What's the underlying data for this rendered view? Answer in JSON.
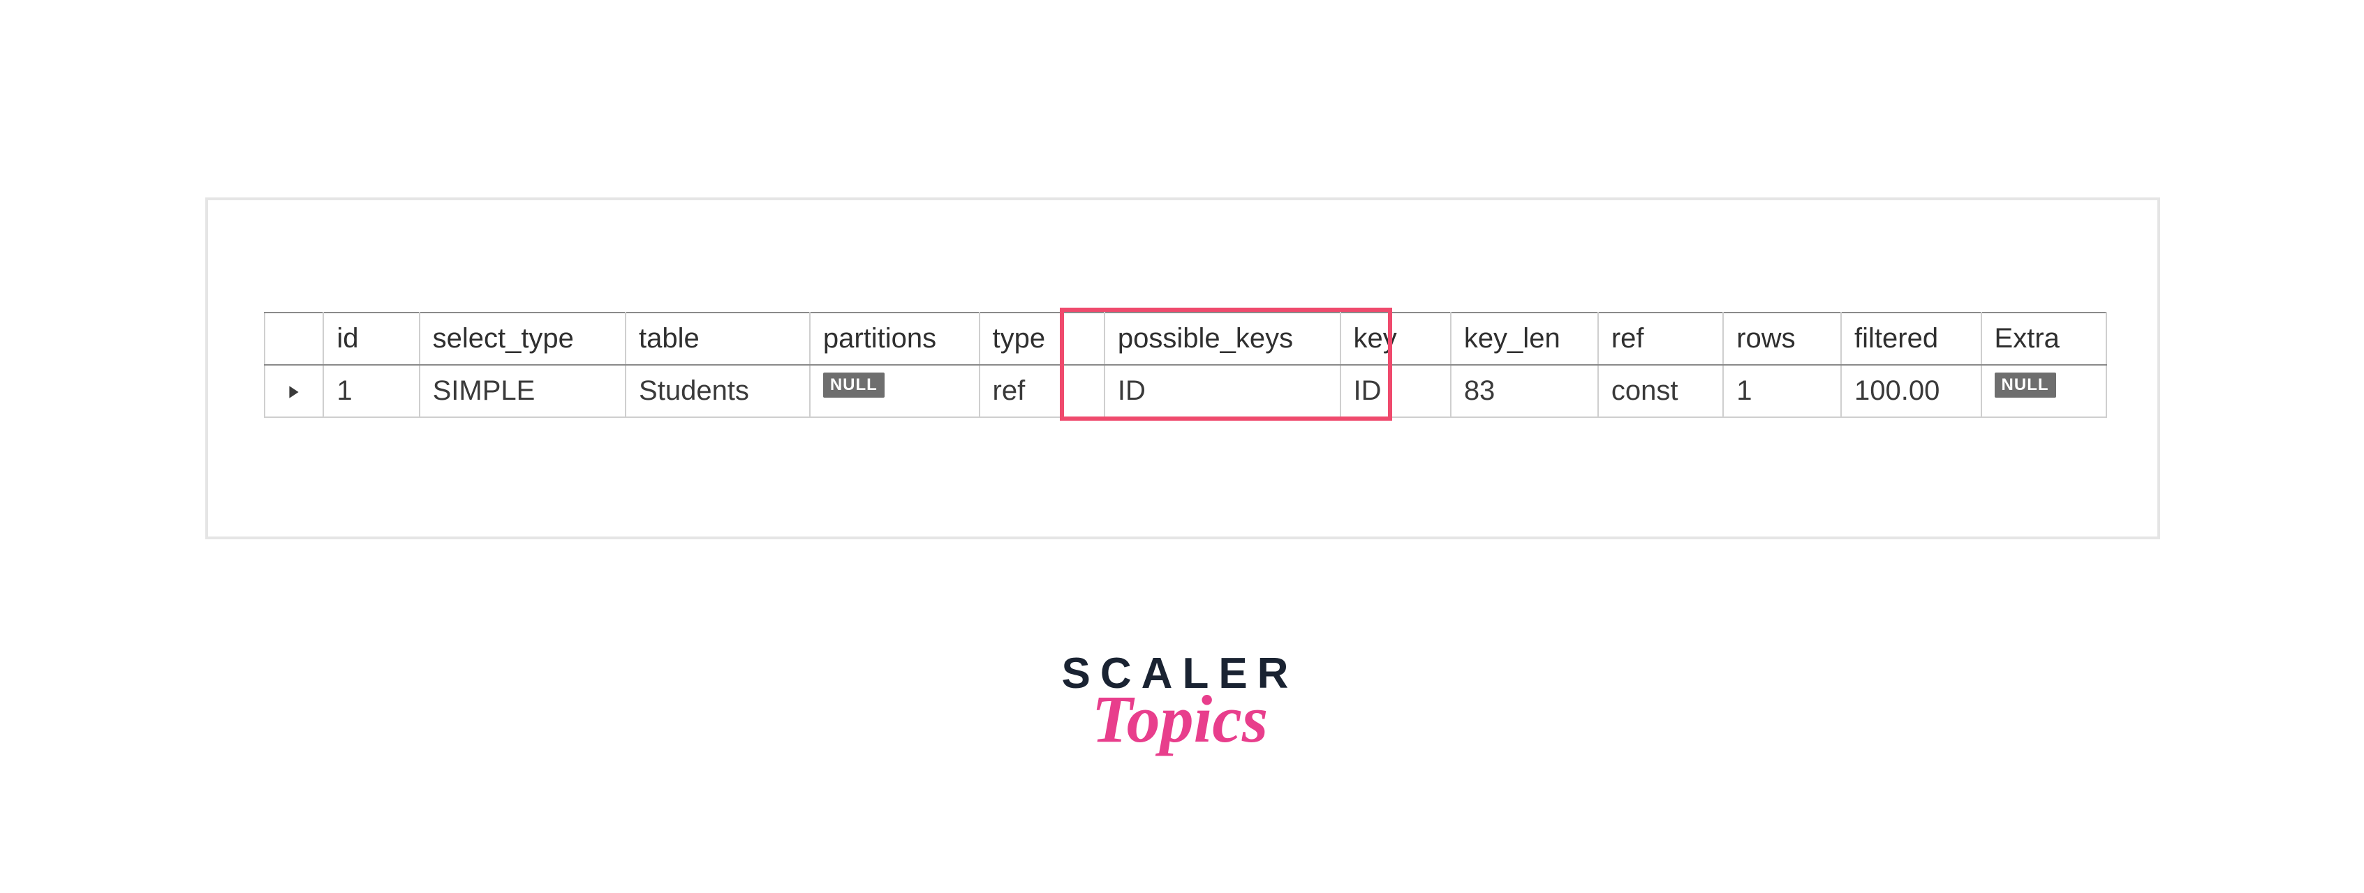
{
  "table": {
    "headers": {
      "handle": "",
      "id": "id",
      "select_type": "select_type",
      "table": "table",
      "partitions": "partitions",
      "type": "type",
      "possible_keys": "possible_keys",
      "key": "key",
      "key_len": "key_len",
      "ref": "ref",
      "rows": "rows",
      "filtered": "filtered",
      "extra": "Extra"
    },
    "row": {
      "id": "1",
      "select_type": "SIMPLE",
      "table": "Students",
      "partitions_null": "NULL",
      "type": "ref",
      "possible_keys": "ID",
      "key": "ID",
      "key_len": "83",
      "ref": "const",
      "rows": "1",
      "filtered": "100.00",
      "extra_null": "NULL"
    }
  },
  "branding": {
    "top": "SCALER",
    "bottom": "Topics"
  },
  "highlight": {
    "columns": [
      "possible_keys",
      "key"
    ]
  }
}
